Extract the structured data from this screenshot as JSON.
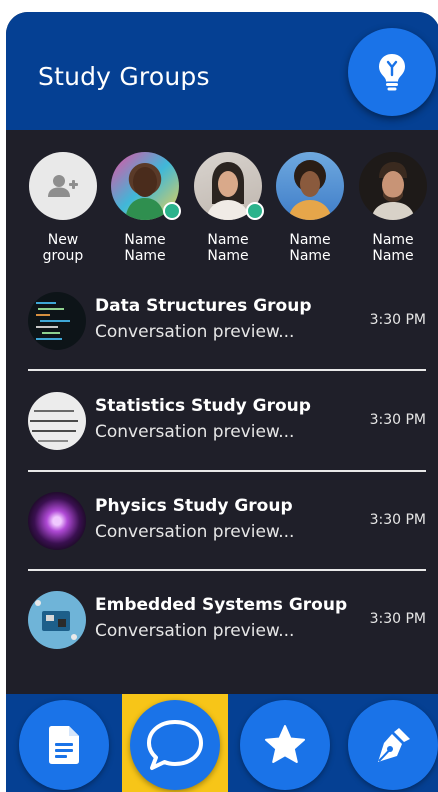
{
  "header": {
    "title": "Study Groups",
    "tip_icon": "lightbulb-icon"
  },
  "contacts": [
    {
      "label": "New\ngroup",
      "icon": "add-user-icon",
      "online": false
    },
    {
      "label": "Name\nName",
      "online": true
    },
    {
      "label": "Name\nName",
      "online": true
    },
    {
      "label": "Name\nName",
      "online": false
    },
    {
      "label": "Name\nName",
      "online": false
    }
  ],
  "conversations": [
    {
      "title": "Data Structures Group",
      "preview": "Conversation preview...",
      "time": "3:30 PM"
    },
    {
      "title": "Statistics Study Group",
      "preview": "Conversation preview...",
      "time": "3:30 PM"
    },
    {
      "title": "Physics Study Group",
      "preview": "Conversation preview...",
      "time": "3:30 PM"
    },
    {
      "title": "Embedded Systems Group",
      "preview": "Conversation preview...",
      "time": "3:30 PM"
    }
  ],
  "bottom_nav": [
    {
      "icon": "document-icon",
      "active": false
    },
    {
      "icon": "chat-bubble-icon",
      "active": true
    },
    {
      "icon": "star-icon",
      "active": false
    },
    {
      "icon": "pen-nib-icon",
      "active": false
    }
  ],
  "colors": {
    "header_bg": "#054093",
    "accent": "#1a73e8",
    "active_tab": "#f7c518",
    "body_bg": "#1f1f29",
    "online": "#2bb38c"
  }
}
